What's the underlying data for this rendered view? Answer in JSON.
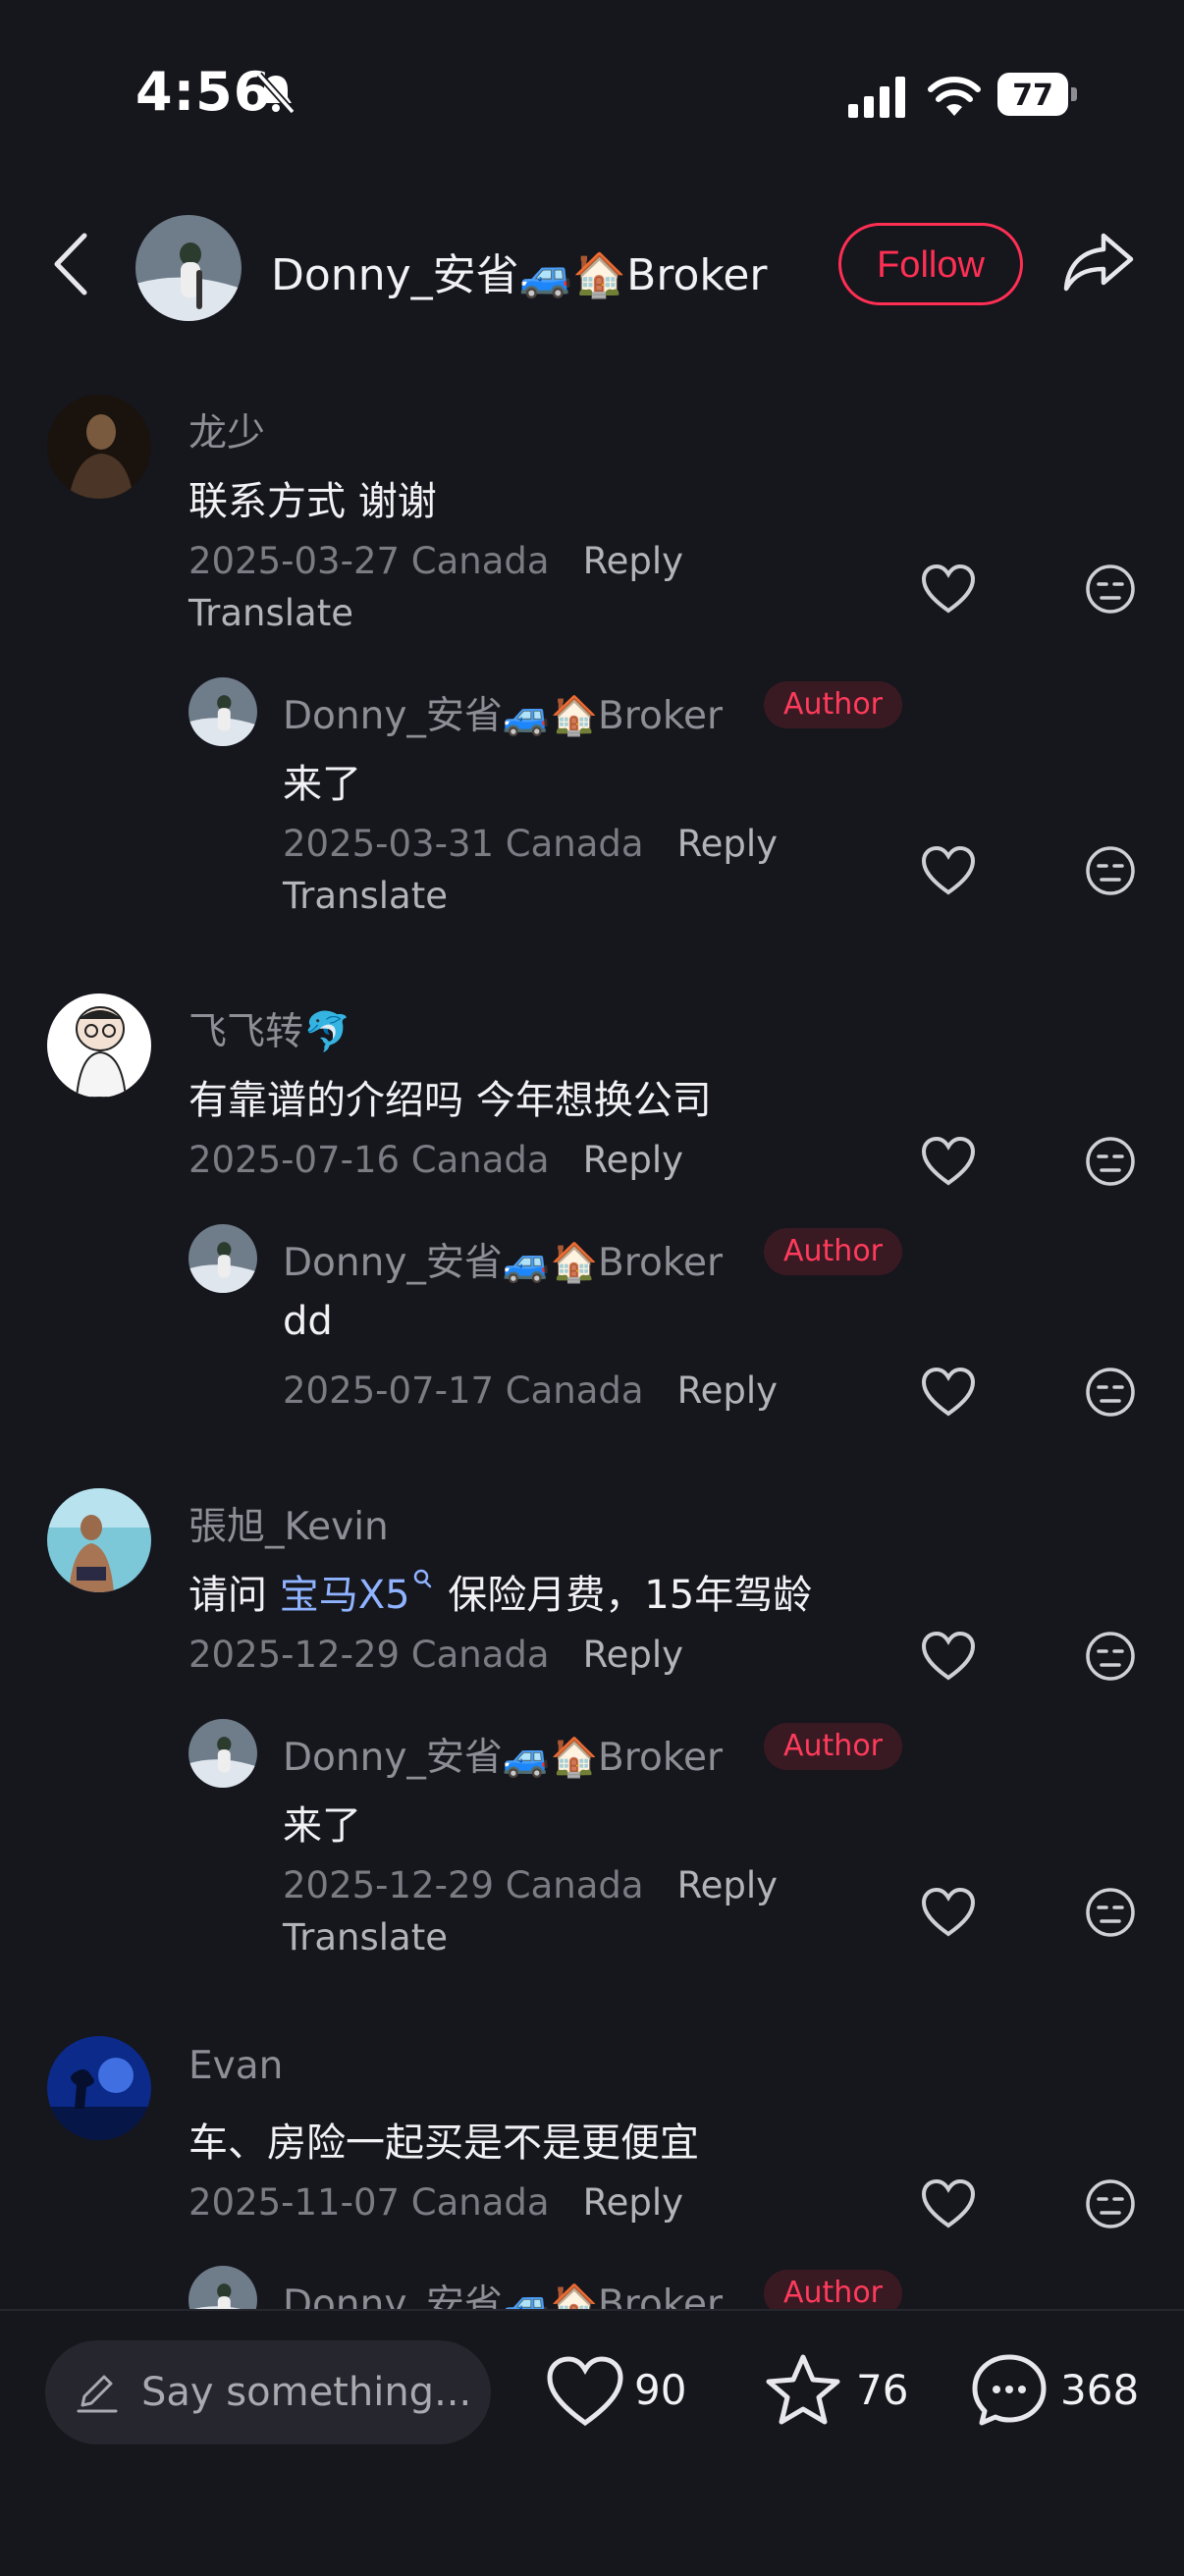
{
  "status_bar": {
    "time": "4:56",
    "battery": "77"
  },
  "header": {
    "username": "Donny_安省🚙🏠Broker",
    "follow_label": "Follow"
  },
  "comments": [
    {
      "user": "龙少",
      "text": "联系方式 谢谢",
      "date": "2025-03-27 Canada",
      "reply_label": "Reply",
      "translate_label": "Translate",
      "reply": {
        "user": "Donny_安省🚙🏠Broker",
        "badge": "Author",
        "text": "来了",
        "date": "2025-03-31 Canada",
        "reply_label": "Reply",
        "translate_label": "Translate"
      }
    },
    {
      "user": "飞飞转🐬",
      "text": "有靠谱的介绍吗  今年想换公司",
      "date": "2025-07-16 Canada",
      "reply_label": "Reply",
      "reply": {
        "user": "Donny_安省🚙🏠Broker",
        "badge": "Author",
        "text": "dd",
        "date": "2025-07-17 Canada",
        "reply_label": "Reply"
      }
    },
    {
      "user": "張旭_Kevin",
      "text_prefix": "请问 ",
      "text_link": "宝马X5",
      "text_suffix": " 保险月费，15年驾龄",
      "date": "2025-12-29 Canada",
      "reply_label": "Reply",
      "reply": {
        "user": "Donny_安省🚙🏠Broker",
        "badge": "Author",
        "text": "来了",
        "date": "2025-12-29 Canada",
        "reply_label": "Reply",
        "translate_label": "Translate"
      }
    },
    {
      "user": "Evan",
      "text": "车、房险一起买是不是更便宜",
      "date": "2025-11-07 Canada",
      "reply_label": "Reply",
      "reply": {
        "user": "Donny_安省🚙🏠Broker",
        "badge": "Author"
      }
    }
  ],
  "bottom_bar": {
    "input_placeholder": "Say something...",
    "likes": "90",
    "favorites": "76",
    "comments": "368"
  },
  "icons": [
    "bell-slash-icon",
    "signal-icon",
    "wifi-icon",
    "battery-icon",
    "back-chevron-icon",
    "share-icon",
    "heart-icon",
    "face-icon",
    "pen-icon",
    "star-icon",
    "comment-bubble-icon"
  ]
}
